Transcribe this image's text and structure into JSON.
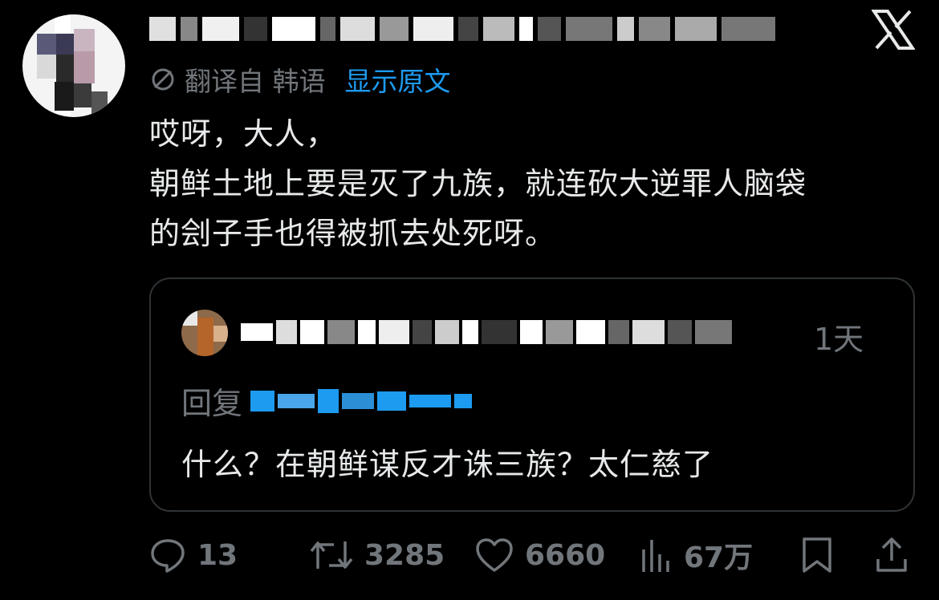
{
  "tweet": {
    "translate": {
      "label": "翻译自 韩语",
      "show_original": "显示原文"
    },
    "body_lines": [
      "哎呀，大人，",
      "朝鲜土地上要是灭了九族，就连砍大逆罪人脑袋",
      "的刽子手也得被抓去处死呀。"
    ],
    "quoted": {
      "time": "1天",
      "reply_prefix": "回复",
      "text": "什么？在朝鲜谋反才诛三族？太仁慈了"
    },
    "actions": {
      "replies": "13",
      "retweets": "3285",
      "likes": "6660",
      "views": "67万"
    }
  },
  "colors": {
    "background": "#000000",
    "text": "#e7e9ea",
    "muted": "#71767b",
    "link": "#1d9bf0",
    "border": "#2f3336"
  },
  "icons": [
    "x-logo-icon",
    "translate-icon",
    "reply-icon",
    "retweet-icon",
    "like-icon",
    "views-icon",
    "bookmark-icon",
    "share-icon"
  ]
}
